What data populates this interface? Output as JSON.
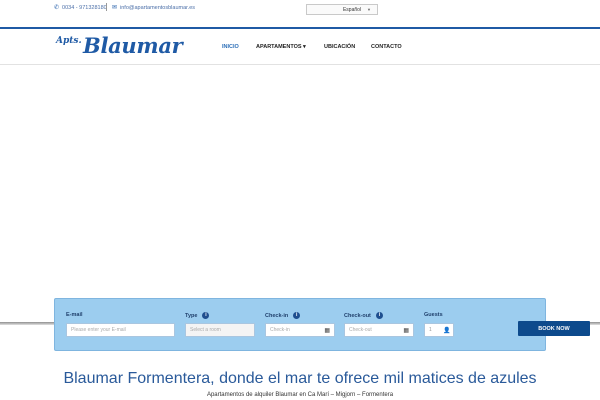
{
  "topbar": {
    "phone_icon": "phone-icon",
    "phone": "0034 - 971328180",
    "email_icon": "envelope-icon",
    "email": "info@apartamentosblaumar.es",
    "language": "Español"
  },
  "header": {
    "logo_apts": "Apts.",
    "logo_brand": "Blaumar",
    "nav": [
      {
        "label": "INICIO",
        "active": true
      },
      {
        "label": "APARTAMENTOS ▾",
        "active": false
      },
      {
        "label": "UBICACIÓN",
        "active": false
      },
      {
        "label": "CONTACTO",
        "active": false
      }
    ]
  },
  "booking": {
    "email_label": "E-mail",
    "email_placeholder": "Please enter your E-mail",
    "type_label": "Type",
    "type_placeholder": "Select a room",
    "checkin_label": "Check-in",
    "checkin_placeholder": "Check-in",
    "checkout_label": "Check-out",
    "checkout_placeholder": "Check-out",
    "guests_label": "Guests",
    "guests_value": "1",
    "button_label": "BOOK NOW"
  },
  "content": {
    "title": "Blaumar Formentera, donde el mar te ofrece mil matices de azules",
    "subtitle": "Apartamentos de alquiler Blaumar en Ca Marí – Migjorn – Formentera"
  },
  "colors": {
    "brand": "#1f5aa5",
    "booking_bg": "#9ccdef",
    "button": "#0d4a8c"
  }
}
